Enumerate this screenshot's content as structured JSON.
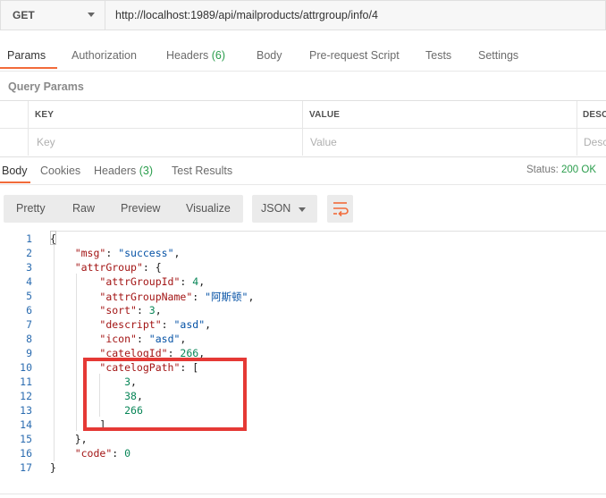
{
  "request": {
    "method": "GET",
    "url": "http://localhost:1989/api/mailproducts/attrgroup/info/4"
  },
  "request_tabs": [
    "Params",
    "Authorization",
    "Headers",
    "Body",
    "Pre-request Script",
    "Tests",
    "Settings"
  ],
  "request_headers_count": "(6)",
  "query_params": {
    "title": "Query Params",
    "columns": [
      "KEY",
      "VALUE",
      "DESCI"
    ],
    "placeholders": [
      "Key",
      "Value",
      "Desc"
    ]
  },
  "response_tabs": [
    "Body",
    "Cookies",
    "Headers",
    "Test Results"
  ],
  "response_headers_count": "(3)",
  "status": {
    "label": "Status:",
    "value": "200 OK"
  },
  "format_tabs": [
    "Pretty",
    "Raw",
    "Preview",
    "Visualize"
  ],
  "format_type": "JSON",
  "icons": {
    "method_dropdown": "chevron-down-icon",
    "format_dropdown": "chevron-down-icon",
    "wrap": "wrap-lines-icon"
  },
  "colors": {
    "accent": "#f26b3a",
    "highlight_box": "#e53935",
    "status_ok": "#2a9d4c"
  },
  "code_lines": [
    {
      "n": "1",
      "t": "{"
    },
    {
      "n": "2",
      "t": "    \"msg\": \"success\","
    },
    {
      "n": "3",
      "t": "    \"attrGroup\": {"
    },
    {
      "n": "4",
      "t": "        \"attrGroupId\": 4,"
    },
    {
      "n": "5",
      "t": "        \"attrGroupName\": \"阿斯顿\","
    },
    {
      "n": "6",
      "t": "        \"sort\": 3,"
    },
    {
      "n": "7",
      "t": "        \"descript\": \"asd\","
    },
    {
      "n": "8",
      "t": "        \"icon\": \"asd\","
    },
    {
      "n": "9",
      "t": "        \"catelogId\": 266,"
    },
    {
      "n": "10",
      "t": "        \"catelogPath\": ["
    },
    {
      "n": "11",
      "t": "            3,"
    },
    {
      "n": "12",
      "t": "            38,"
    },
    {
      "n": "13",
      "t": "            266"
    },
    {
      "n": "14",
      "t": "        ]"
    },
    {
      "n": "15",
      "t": "    },"
    },
    {
      "n": "16",
      "t": "    \"code\": 0"
    },
    {
      "n": "17",
      "t": "}"
    }
  ]
}
